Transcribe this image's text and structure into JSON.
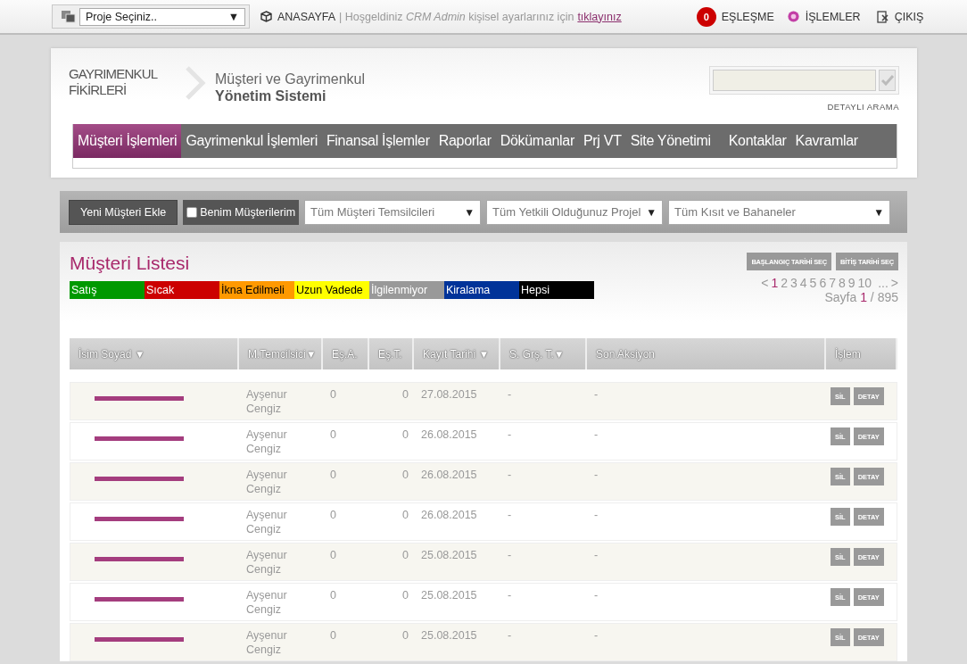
{
  "topbar": {
    "project_select": {
      "value": "Proje Seçiniz..",
      "arrow": "▼"
    },
    "home": "ANASAYFA",
    "welcome": "| Hoşgeldiniz *CRM Admin* kişisel ayarlarınız için",
    "settings_link": "tıklayınız",
    "match_count": "0",
    "match": "EŞLEŞME",
    "operations": "İŞLEMLER",
    "logout": "ÇIKIŞ"
  },
  "header": {
    "logo_line1": "GAYRIMENKUL",
    "logo_line2": "FİKİRLERİ",
    "subtitle1": "Müşteri ve Gayrimenkul",
    "subtitle2": "Yönetim Sistemi",
    "advanced_search": "DETAYLI ARAMA"
  },
  "nav": [
    {
      "label": "Müşteri İşlemleri",
      "selected": true
    },
    {
      "label": "Gayrimenkul İşlemleri",
      "selected": false
    },
    {
      "label": "Finansal İşlemler",
      "selected": false
    },
    {
      "label": "Raporlar",
      "selected": false
    },
    {
      "label": "Dökümanlar",
      "selected": false
    },
    {
      "label": "Prj VT",
      "selected": false
    },
    {
      "label": "Site Yönetimi",
      "selected": false
    },
    {
      "label": "Kontaklar",
      "selected": false
    },
    {
      "label": "Kavramlar",
      "selected": false
    }
  ],
  "toolbar": {
    "new_button": "Yeni Müşteri Ekle",
    "my_customers": {
      "label": "Benim Müşterilerim",
      "checked": false
    },
    "filters": [
      {
        "value": "Tüm Müşteri Temsilcileri",
        "arrow": "▼"
      },
      {
        "value": "Tüm Yetkili Olduğunuz Projel",
        "arrow": "▼"
      },
      {
        "value": "Tüm Kısıt ve Bahaneler",
        "arrow": "▼"
      }
    ]
  },
  "list": {
    "title": "Müşteri Listesi",
    "date_buttons": [
      "BAŞLANGIÇ TARİHİ SEÇ",
      "BİTİŞ TARİHİ SEÇ"
    ],
    "categories": [
      {
        "label": "Satış",
        "color": "#009900"
      },
      {
        "label": "Sıcak",
        "color": "#cc0000"
      },
      {
        "label": "İkna Edilmeli",
        "color": "#ff9900"
      },
      {
        "label": "Uzun Vadede",
        "color": "#ffff00"
      },
      {
        "label": "İlgilenmiyor",
        "color": "#999999"
      },
      {
        "label": "Kiralama",
        "color": "#003399"
      },
      {
        "label": "Hepsi",
        "color": "#000000"
      }
    ],
    "pagination": {
      "prev": "<",
      "pages": [
        {
          "label": "1",
          "selected": true
        },
        {
          "label": "2",
          "selected": false
        },
        {
          "label": "3",
          "selected": false
        },
        {
          "label": "4",
          "selected": false
        },
        {
          "label": "5",
          "selected": false
        },
        {
          "label": "6",
          "selected": false
        },
        {
          "label": "7",
          "selected": false
        },
        {
          "label": "8",
          "selected": false
        },
        {
          "label": "9",
          "selected": false
        },
        {
          "label": "10",
          "selected": false
        }
      ],
      "more": "...",
      "next": ">",
      "page_label": "Sayfa",
      "current": "1",
      "total": "/ 895"
    },
    "columns": [
      "İsim Soyad ▼",
      "M.Temcilsici▼",
      "Eş.A.",
      "Eş.T.",
      "Kayıt Tarihi ▼",
      "S. Grş. T.▼",
      "Son Aksiyon",
      "İşlem"
    ],
    "rows": [
      {
        "name_redacted": true,
        "rep": "Ayşenur Cengiz",
        "ea": "0",
        "et": "0",
        "date": "27.08.2015",
        "last_visit": "-",
        "last_action": "-",
        "delete": "SİL",
        "detail": "DETAY"
      },
      {
        "name_redacted": true,
        "rep": "Ayşenur Cengiz",
        "ea": "0",
        "et": "0",
        "date": "26.08.2015",
        "last_visit": "-",
        "last_action": "-",
        "delete": "SİL",
        "detail": "DETAY"
      },
      {
        "name_redacted": true,
        "rep": "Ayşenur Cengiz",
        "ea": "0",
        "et": "0",
        "date": "26.08.2015",
        "last_visit": "-",
        "last_action": "-",
        "delete": "SİL",
        "detail": "DETAY"
      },
      {
        "name_redacted": true,
        "rep": "Ayşenur Cengiz",
        "ea": "0",
        "et": "0",
        "date": "26.08.2015",
        "last_visit": "-",
        "last_action": "-",
        "delete": "SİL",
        "detail": "DETAY"
      },
      {
        "name_redacted": true,
        "rep": "Ayşenur Cengiz",
        "ea": "0",
        "et": "0",
        "date": "25.08.2015",
        "last_visit": "-",
        "last_action": "-",
        "delete": "SİL",
        "detail": "DETAY"
      },
      {
        "name_redacted": true,
        "rep": "Ayşenur Cengiz",
        "ea": "0",
        "et": "0",
        "date": "25.08.2015",
        "last_visit": "-",
        "last_action": "-",
        "delete": "SİL",
        "detail": "DETAY"
      },
      {
        "name_redacted": true,
        "rep": "Ayşenur Cengiz",
        "ea": "0",
        "et": "0",
        "date": "25.08.2015",
        "last_visit": "-",
        "last_action": "-",
        "delete": "SİL",
        "detail": "DETAY"
      }
    ]
  }
}
